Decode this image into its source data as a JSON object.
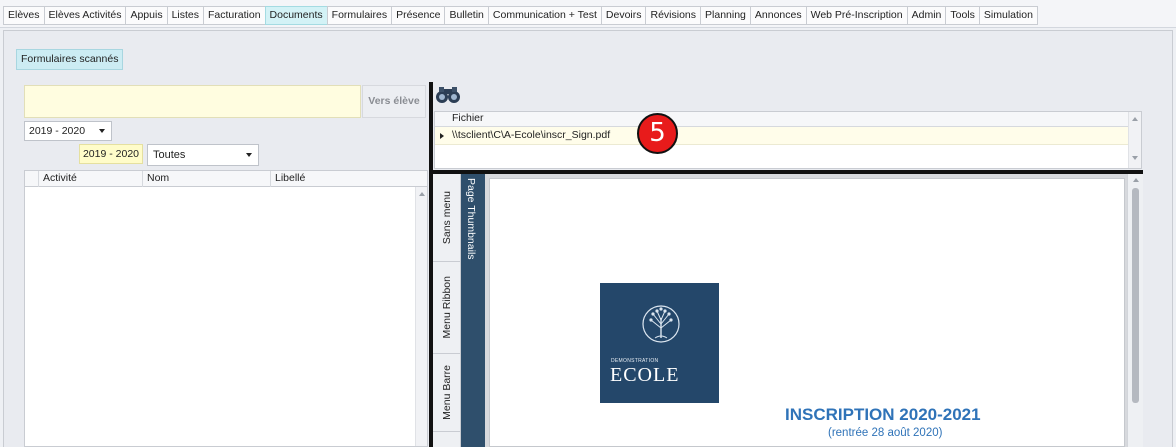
{
  "nav": {
    "tabs": [
      "Elèves",
      "Elèves Activités",
      "Appuis",
      "Listes",
      "Facturation",
      "Documents",
      "Formulaires",
      "Présence",
      "Bulletin",
      "Communication + Test",
      "Devoirs",
      "Révisions",
      "Planning",
      "Annonces",
      "Web Pré-Inscription",
      "Admin",
      "Tools",
      "Simulation"
    ],
    "active": "Documents"
  },
  "subtab": {
    "label": "Formulaires scannés"
  },
  "left": {
    "search_value": "",
    "vers_eleve_label": "Vers élève",
    "year_select_value": "2019 - 2020",
    "year_tag": "2019 - 2020",
    "filter_select_value": "Toutes",
    "grid_columns": [
      "Activité",
      "Nom",
      "Libellé"
    ]
  },
  "files": {
    "search_icon": "binoculars-icon",
    "column": "Fichier",
    "rows": [
      "\\\\tsclient\\C\\A-Ecole\\inscr_Sign.pdf"
    ]
  },
  "annotation": {
    "badge": "5"
  },
  "viewer": {
    "side_tabs": [
      "Sans menu",
      "Menu Ribbon",
      "Menu Barre"
    ],
    "thumbnails_tab": "Page Thumbnails",
    "logo_small": "DEMONSTRATION",
    "logo_big": "ECOLE",
    "doc_title": "INSCRIPTION 2020-2021",
    "doc_subtitle": "(rentrée 28 août 2020)"
  },
  "colors": {
    "active_tab": "#d3f2f6",
    "search_field": "#fffde0",
    "logo_bg": "#24476a",
    "doc_title": "#2f73b8",
    "badge": "#e81b1b"
  }
}
